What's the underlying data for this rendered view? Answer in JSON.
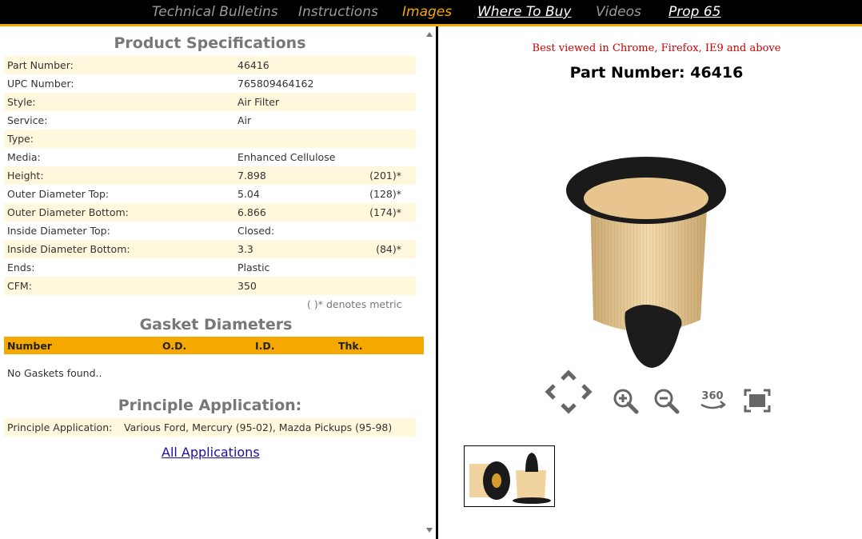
{
  "nav": {
    "items": [
      {
        "label": "Technical Bulletins"
      },
      {
        "label": "Instructions"
      },
      {
        "label": "Images"
      },
      {
        "label": "Where To Buy"
      },
      {
        "label": "Videos"
      },
      {
        "label": "Prop 65"
      }
    ],
    "active": "Images"
  },
  "specs": {
    "title": "Product Specifications",
    "rows": [
      {
        "label": "Part Number:",
        "value": "46416",
        "metric": ""
      },
      {
        "label": "UPC Number:",
        "value": "765809464162",
        "metric": ""
      },
      {
        "label": "Style:",
        "value": "Air Filter",
        "metric": ""
      },
      {
        "label": "Service:",
        "value": "Air",
        "metric": ""
      },
      {
        "label": "Type:",
        "value": "",
        "metric": ""
      },
      {
        "label": "Media:",
        "value": "Enhanced Cellulose",
        "metric": ""
      },
      {
        "label": "Height:",
        "value": "7.898",
        "metric": "(201)*"
      },
      {
        "label": "Outer Diameter Top:",
        "value": "5.04",
        "metric": "(128)*"
      },
      {
        "label": "Outer Diameter Bottom:",
        "value": "6.866",
        "metric": "(174)*"
      },
      {
        "label": "Inside Diameter Top:",
        "value": "Closed:",
        "metric": ""
      },
      {
        "label": "Inside Diameter Bottom:",
        "value": "3.3",
        "metric": "(84)*"
      },
      {
        "label": "Ends:",
        "value": "Plastic",
        "metric": ""
      },
      {
        "label": "CFM:",
        "value": "350",
        "metric": ""
      }
    ],
    "metric_note": "( )* denotes metric"
  },
  "gaskets": {
    "title": "Gasket Diameters",
    "columns": [
      "Number",
      "O.D.",
      "I.D.",
      "Thk."
    ],
    "empty_text": "No Gaskets found.."
  },
  "application": {
    "title": "Principle Application:",
    "label": "Principle Application:",
    "value": "Various Ford, Mercury (95-02), Mazda Pickups (95-98)",
    "all_link": "All Applications"
  },
  "viewer": {
    "browser_note": "Best viewed in Chrome, Firefox, IE9 and above",
    "part_title": "Part Number: 46416",
    "rotate_label": "360"
  },
  "colors": {
    "accent": "#f5a800",
    "nav_bg": "#000000",
    "row_shade": "#fff8dc",
    "note_red": "#cc0000",
    "link": "#1a0dab"
  }
}
